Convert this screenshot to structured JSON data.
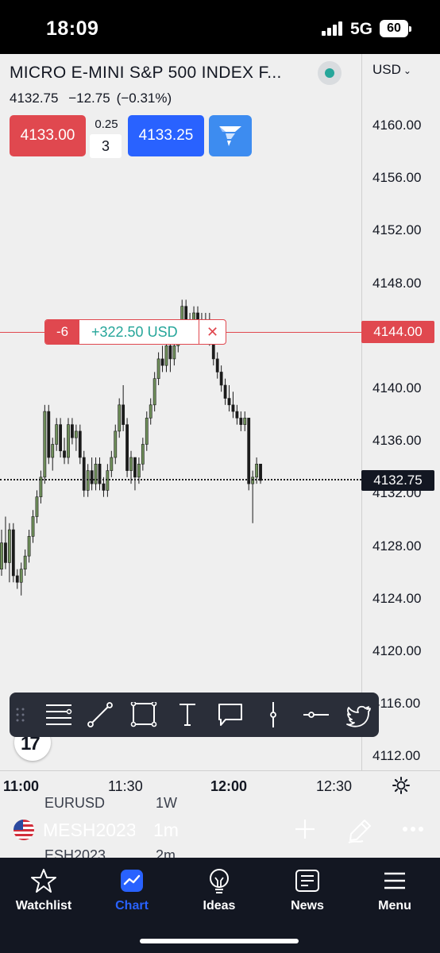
{
  "status_bar": {
    "time": "18:09",
    "network": "5G",
    "battery": "60"
  },
  "header": {
    "title": "MICRO E-MINI S&P 500 INDEX F...",
    "last": "4132.75",
    "change": "−12.75",
    "change_pct": "(−0.31%)"
  },
  "trade": {
    "sell_price": "4133.00",
    "tick": "0.25",
    "qty": "3",
    "buy_price": "4133.25"
  },
  "price_axis": {
    "currency": "USD",
    "labels": [
      "4160.00",
      "4156.00",
      "4152.00",
      "4148.00",
      "4144.00",
      "4140.00",
      "4136.00",
      "4132.00",
      "4128.00",
      "4124.00",
      "4120.00",
      "4116.00",
      "4112.00"
    ]
  },
  "position": {
    "qty": "-6",
    "pnl": "+322.50 USD",
    "close": "✕",
    "price": "4144.00"
  },
  "current_price": "4132.75",
  "time_axis": {
    "labels": [
      "11:00",
      "11:30",
      "12:00",
      "12:30"
    ]
  },
  "drawing_tools": [
    "lines-menu-icon",
    "trend-line-icon",
    "rectangle-icon",
    "text-icon",
    "callout-icon",
    "vertical-line-icon",
    "horizontal-line-icon",
    "twitter-icon"
  ],
  "symbol_bar": {
    "symbol": "MESH2023",
    "timeframe": "1m",
    "ghost_top_symbol": "EURUSD",
    "ghost_top_tf": "1W",
    "ghost_bottom_symbol": "ESH2023",
    "ghost_bottom_tf": "2m"
  },
  "tabs": [
    {
      "label": "Watchlist",
      "icon": "star-icon"
    },
    {
      "label": "Chart",
      "icon": "chart-icon",
      "active": true
    },
    {
      "label": "Ideas",
      "icon": "lightbulb-icon"
    },
    {
      "label": "News",
      "icon": "news-icon"
    },
    {
      "label": "Menu",
      "icon": "menu-icon"
    }
  ],
  "colors": {
    "up": "#26a69a",
    "down": "#e0484f",
    "accent": "#2962ff",
    "candle_up_fill": "#6f8f5a",
    "candle_down_fill": "#1b1b1b"
  },
  "candles": [
    [
      4126.0,
      4129.0,
      4125.5,
      4128.0
    ],
    [
      4128.0,
      4130.0,
      4126.0,
      4126.5
    ],
    [
      4126.5,
      4129.5,
      4125.0,
      4129.0
    ],
    [
      4129.0,
      4129.5,
      4125.0,
      4125.5
    ],
    [
      4125.5,
      4126.0,
      4124.5,
      4125.0
    ],
    [
      4125.0,
      4126.5,
      4124.0,
      4126.0
    ],
    [
      4126.0,
      4127.5,
      4125.5,
      4127.0
    ],
    [
      4127.0,
      4129.0,
      4126.5,
      4128.5
    ],
    [
      4128.5,
      4130.5,
      4128.0,
      4130.0
    ],
    [
      4130.0,
      4132.0,
      4129.5,
      4131.5
    ],
    [
      4131.5,
      4133.5,
      4131.0,
      4133.0
    ],
    [
      4133.0,
      4138.5,
      4132.5,
      4138.0
    ],
    [
      4138.0,
      4138.5,
      4134.0,
      4134.5
    ],
    [
      4134.5,
      4136.0,
      4133.5,
      4135.5
    ],
    [
      4135.5,
      4137.5,
      4135.0,
      4137.0
    ],
    [
      4137.0,
      4137.5,
      4134.5,
      4135.0
    ],
    [
      4135.0,
      4136.0,
      4134.0,
      4134.5
    ],
    [
      4134.5,
      4137.5,
      4134.0,
      4137.0
    ],
    [
      4137.0,
      4137.5,
      4135.5,
      4136.0
    ],
    [
      4136.0,
      4137.0,
      4135.0,
      4136.5
    ],
    [
      4136.5,
      4137.0,
      4134.0,
      4134.5
    ],
    [
      4134.5,
      4135.0,
      4131.5,
      4132.0
    ],
    [
      4132.0,
      4134.0,
      4131.5,
      4133.5
    ],
    [
      4133.5,
      4134.5,
      4132.0,
      4132.5
    ],
    [
      4132.5,
      4134.5,
      4132.0,
      4134.0
    ],
    [
      4134.0,
      4134.5,
      4132.0,
      4132.5
    ],
    [
      4132.5,
      4133.0,
      4131.5,
      4132.0
    ],
    [
      4132.0,
      4134.0,
      4131.5,
      4133.5
    ],
    [
      4133.5,
      4135.0,
      4133.0,
      4134.5
    ],
    [
      4134.5,
      4137.0,
      4134.0,
      4136.5
    ],
    [
      4136.5,
      4139.0,
      4136.0,
      4138.5
    ],
    [
      4138.5,
      4140.0,
      4136.5,
      4137.0
    ],
    [
      4137.0,
      4137.5,
      4133.0,
      4133.5
    ],
    [
      4133.5,
      4135.0,
      4132.5,
      4134.5
    ],
    [
      4134.5,
      4134.5,
      4132.0,
      4133.0
    ],
    [
      4133.0,
      4134.5,
      4132.5,
      4134.0
    ],
    [
      4134.0,
      4136.0,
      4133.5,
      4135.5
    ],
    [
      4135.5,
      4138.0,
      4135.0,
      4137.5
    ],
    [
      4137.5,
      4139.0,
      4137.0,
      4138.5
    ],
    [
      4138.5,
      4141.0,
      4138.0,
      4140.5
    ],
    [
      4140.5,
      4142.5,
      4140.0,
      4142.0
    ],
    [
      4142.0,
      4143.0,
      4141.0,
      4141.5
    ],
    [
      4141.5,
      4143.5,
      4141.0,
      4143.0
    ],
    [
      4143.0,
      4144.5,
      4141.0,
      4142.0
    ],
    [
      4142.0,
      4143.5,
      4141.5,
      4143.0
    ],
    [
      4143.0,
      4145.0,
      4142.5,
      4144.5
    ],
    [
      4144.5,
      4146.5,
      4144.0,
      4146.0
    ],
    [
      4146.0,
      4146.5,
      4144.5,
      4145.0
    ],
    [
      4145.0,
      4145.5,
      4143.5,
      4144.0
    ],
    [
      4144.0,
      4146.0,
      4143.5,
      4145.5
    ],
    [
      4145.5,
      4146.0,
      4144.5,
      4145.0
    ],
    [
      4145.0,
      4145.5,
      4143.5,
      4144.0
    ],
    [
      4144.0,
      4145.5,
      4143.5,
      4145.0
    ],
    [
      4145.0,
      4145.5,
      4143.0,
      4143.5
    ],
    [
      4143.5,
      4144.0,
      4141.5,
      4142.0
    ],
    [
      4142.0,
      4142.5,
      4140.5,
      4141.0
    ],
    [
      4141.0,
      4141.5,
      4139.5,
      4140.0
    ],
    [
      4140.0,
      4140.5,
      4138.5,
      4139.0
    ],
    [
      4139.0,
      4140.0,
      4138.0,
      4138.5
    ],
    [
      4138.5,
      4139.5,
      4137.5,
      4138.0
    ],
    [
      4138.0,
      4138.5,
      4137.0,
      4137.5
    ],
    [
      4137.5,
      4138.0,
      4136.5,
      4137.0
    ],
    [
      4137.0,
      4138.0,
      4136.5,
      4137.5
    ],
    [
      4137.5,
      4137.5,
      4132.0,
      4132.5
    ],
    [
      4132.5,
      4133.5,
      4129.5,
      4133.0
    ],
    [
      4133.0,
      4134.5,
      4132.5,
      4134.0
    ],
    [
      4134.0,
      4134.0,
      4132.5,
      4132.75
    ]
  ]
}
